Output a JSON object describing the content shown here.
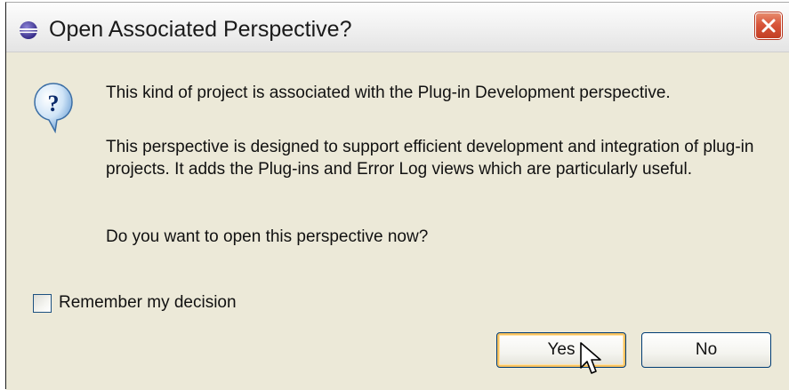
{
  "dialog": {
    "title": "Open Associated Perspective?",
    "title_icon": "perspective-globe-icon",
    "close_icon": "close-icon",
    "message_icon": "question-icon",
    "message_line1": "This kind of project is associated with the Plug-in Development perspective.",
    "message_line2": "This perspective is designed to support efficient development and integration of plug-in projects.  It adds the Plug-ins and Error Log views which are particularly useful.",
    "message_line3": "Do you want to open this perspective now?",
    "remember_label": "Remember my decision",
    "remember_checked": false,
    "yes_label": "Yes",
    "no_label": "No",
    "cursor_icon": "mouse-pointer-icon",
    "colors": {
      "close_button": "#d8553a",
      "default_button_focus": "#f8c25f",
      "button_border": "#003c74",
      "dialog_background": "#ece9d8"
    }
  }
}
